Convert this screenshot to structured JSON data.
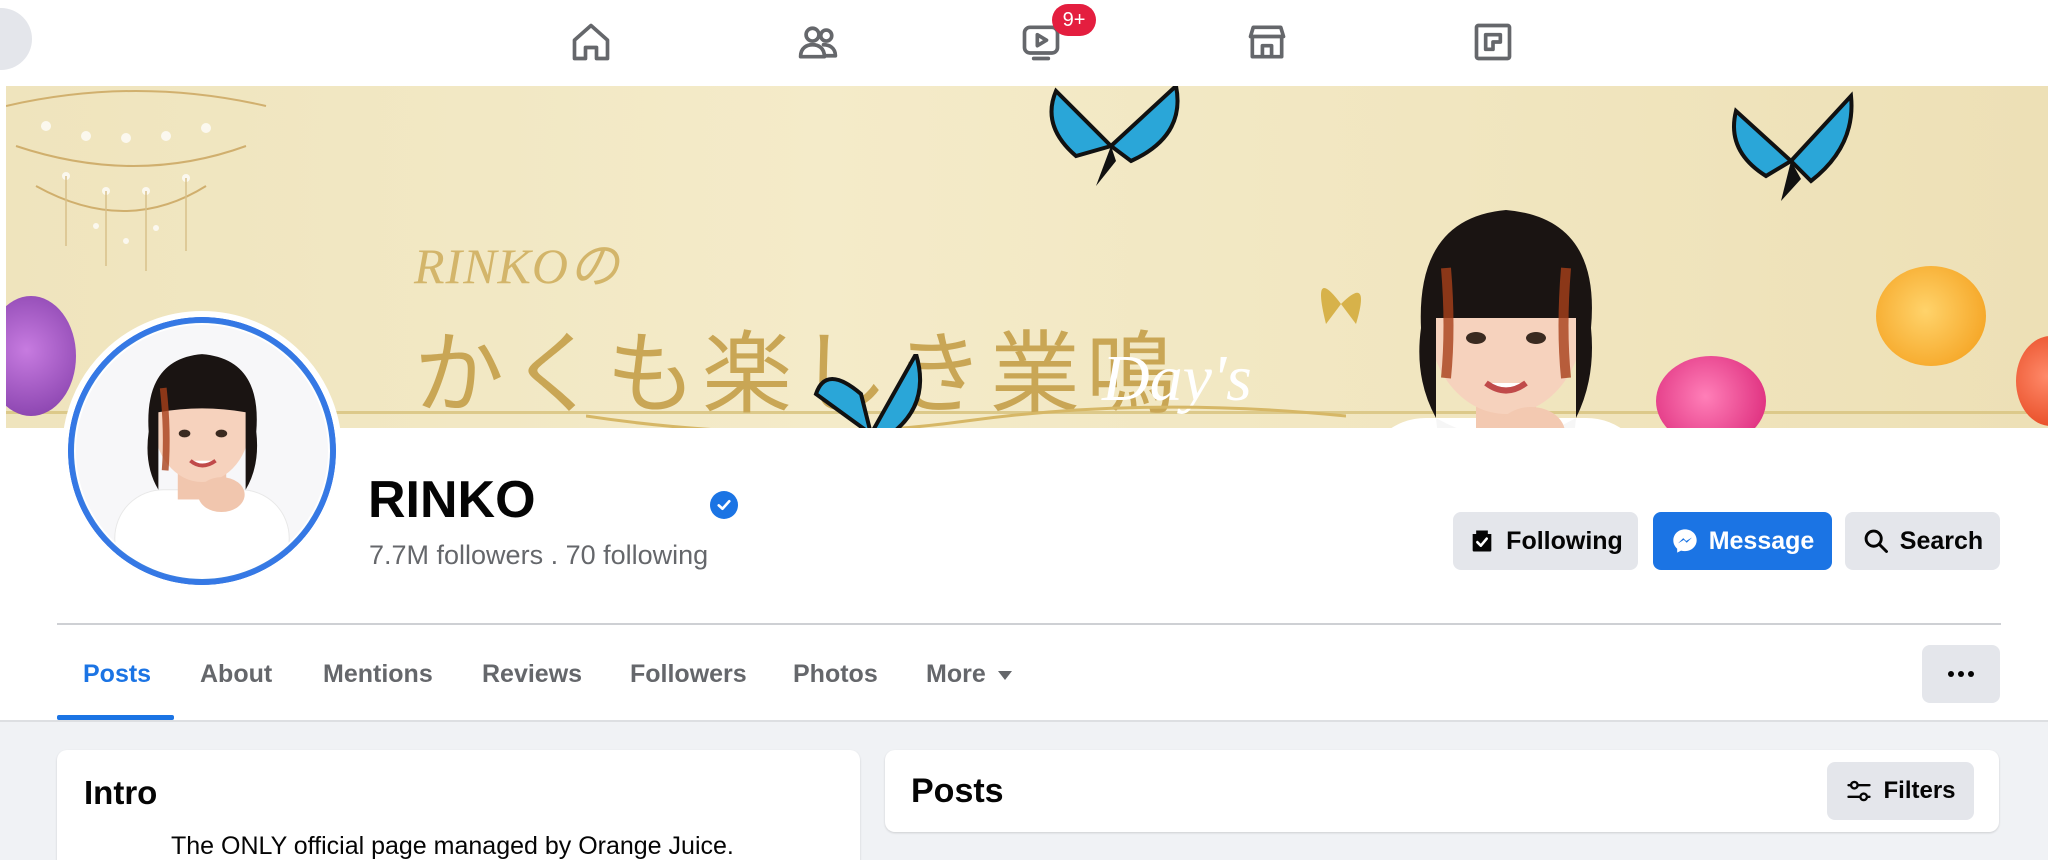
{
  "top_nav": {
    "items": [
      {
        "icon": "home-icon"
      },
      {
        "icon": "friends-icon"
      },
      {
        "icon": "watch-icon",
        "badge": "9+"
      },
      {
        "icon": "marketplace-icon"
      },
      {
        "icon": "gaming-icon"
      }
    ]
  },
  "cover": {
    "title_line_1": "RINKOの",
    "title_line_2": "かくも楽しき業鳴",
    "title_line_3": "Day's"
  },
  "profile": {
    "name": "RINKO",
    "stats": "7.7M followers . 70 following",
    "verified": true
  },
  "actions": {
    "following_label": "Following",
    "message_label": "Message",
    "search_label": "Search"
  },
  "tabs": {
    "items": [
      "Posts",
      "About",
      "Mentions",
      "Reviews",
      "Followers",
      "Photos",
      "More"
    ],
    "active": "Posts"
  },
  "intro": {
    "title": "Intro",
    "text": "The ONLY official page managed by Orange Juice."
  },
  "posts": {
    "title": "Posts",
    "filters_label": "Filters"
  },
  "colors": {
    "accent": "#1b74e4",
    "badge": "#e41e3f",
    "secondary_text": "#65676b"
  }
}
